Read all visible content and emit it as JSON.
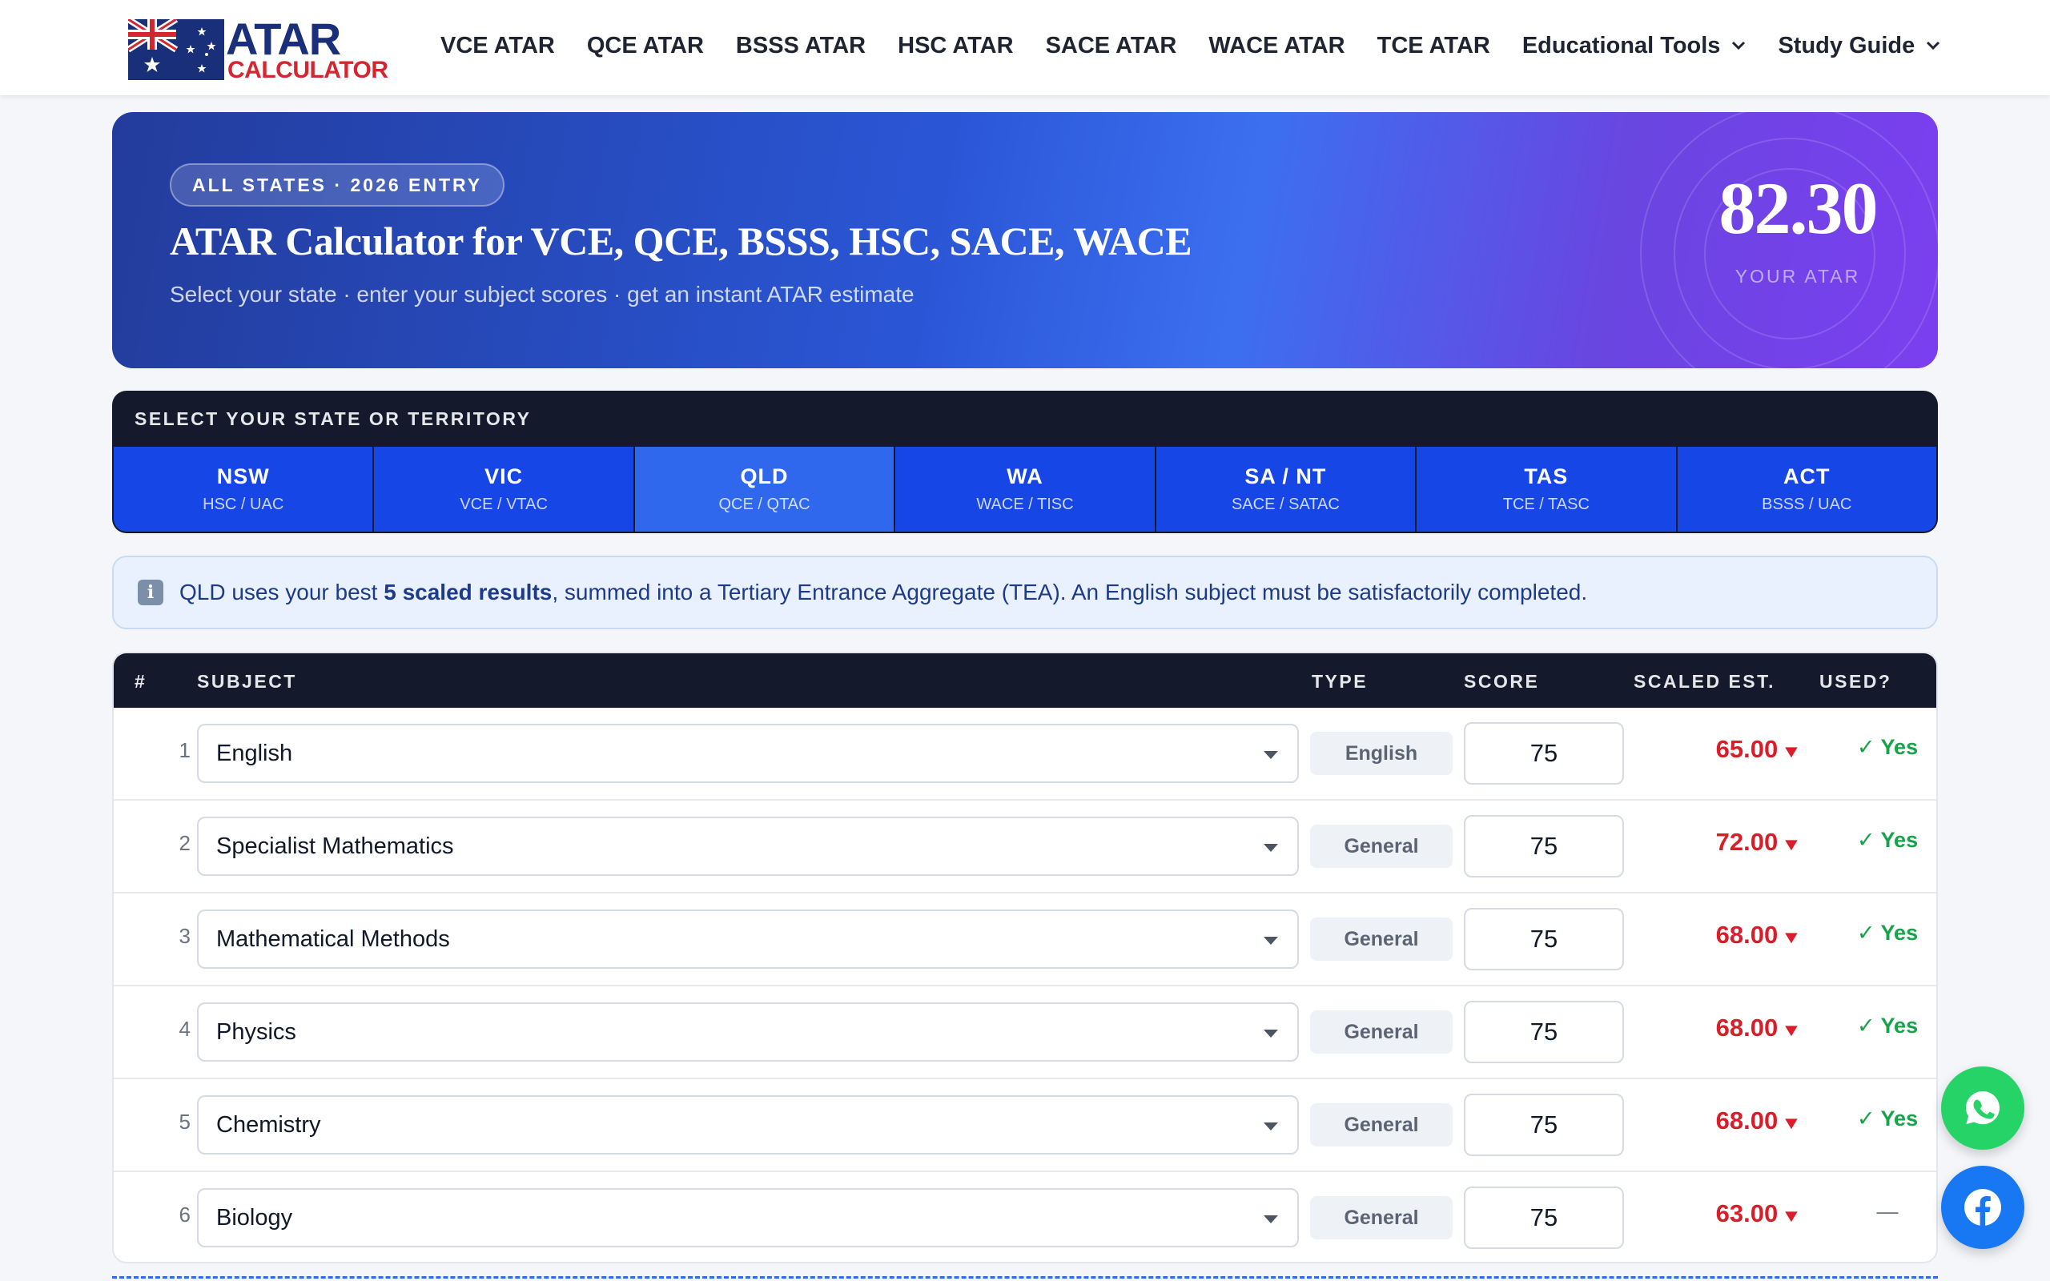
{
  "logo": {
    "top": "ATAR",
    "bottom": "CALCULATOR"
  },
  "nav": {
    "links": [
      {
        "label": "VCE ATAR"
      },
      {
        "label": "QCE ATAR"
      },
      {
        "label": "BSSS ATAR"
      },
      {
        "label": "HSC ATAR"
      },
      {
        "label": "SACE ATAR"
      },
      {
        "label": "WACE ATAR"
      },
      {
        "label": "TCE ATAR"
      },
      {
        "label": "Educational Tools",
        "dropdown": true
      },
      {
        "label": "Study Guide",
        "dropdown": true
      }
    ]
  },
  "hero": {
    "pill": "ALL STATES · 2026 ENTRY",
    "title": "ATAR Calculator for VCE, QCE, BSSS, HSC, SACE, WACE",
    "subtitle": "Select your state · enter your subject scores · get an instant ATAR estimate",
    "score": "82.30",
    "score_label": "YOUR ATAR"
  },
  "states": {
    "heading": "SELECT YOUR STATE OR TERRITORY",
    "selected": "QLD",
    "tabs": [
      {
        "code": "NSW",
        "system": "HSC / UAC"
      },
      {
        "code": "VIC",
        "system": "VCE / VTAC"
      },
      {
        "code": "QLD",
        "system": "QCE / QTAC"
      },
      {
        "code": "WA",
        "system": "WACE / TISC"
      },
      {
        "code": "SA / NT",
        "system": "SACE / SATAC"
      },
      {
        "code": "TAS",
        "system": "TCE / TASC"
      },
      {
        "code": "ACT",
        "system": "BSSS / UAC"
      }
    ]
  },
  "info": {
    "icon": "info-icon",
    "prefix": "QLD uses your best ",
    "highlight": "5 scaled results",
    "suffix": ", summed into a Tertiary Entrance Aggregate (TEA). An English subject must be satisfactorily completed."
  },
  "table": {
    "headers": {
      "num": "#",
      "subject": "SUBJECT",
      "type": "TYPE",
      "score": "SCORE",
      "scaled": "SCALED EST.",
      "used": "USED?"
    },
    "rows": [
      {
        "num": "1",
        "subject": "English",
        "type": "English",
        "score": "75",
        "scaled": "65.00",
        "used": "✓ Yes"
      },
      {
        "num": "2",
        "subject": "Specialist Mathematics",
        "type": "General",
        "score": "75",
        "scaled": "72.00",
        "used": "✓ Yes"
      },
      {
        "num": "3",
        "subject": "Mathematical Methods",
        "type": "General",
        "score": "75",
        "scaled": "68.00",
        "used": "✓ Yes"
      },
      {
        "num": "4",
        "subject": "Physics",
        "type": "General",
        "score": "75",
        "scaled": "68.00",
        "used": "✓ Yes"
      },
      {
        "num": "5",
        "subject": "Chemistry",
        "type": "General",
        "score": "75",
        "scaled": "68.00",
        "used": "✓ Yes"
      },
      {
        "num": "6",
        "subject": "Biology",
        "type": "General",
        "score": "75",
        "scaled": "63.00",
        "used": "—"
      }
    ],
    "scaled_trend_icon": "down-triangle-icon"
  },
  "floating": {
    "whatsapp": "whatsapp-icon",
    "facebook": "facebook-icon"
  },
  "colors": {
    "brand_blue": "#1746e6",
    "dark_header": "#141a2c",
    "scaled_red": "#d91e2a",
    "used_green": "#16a34a"
  }
}
